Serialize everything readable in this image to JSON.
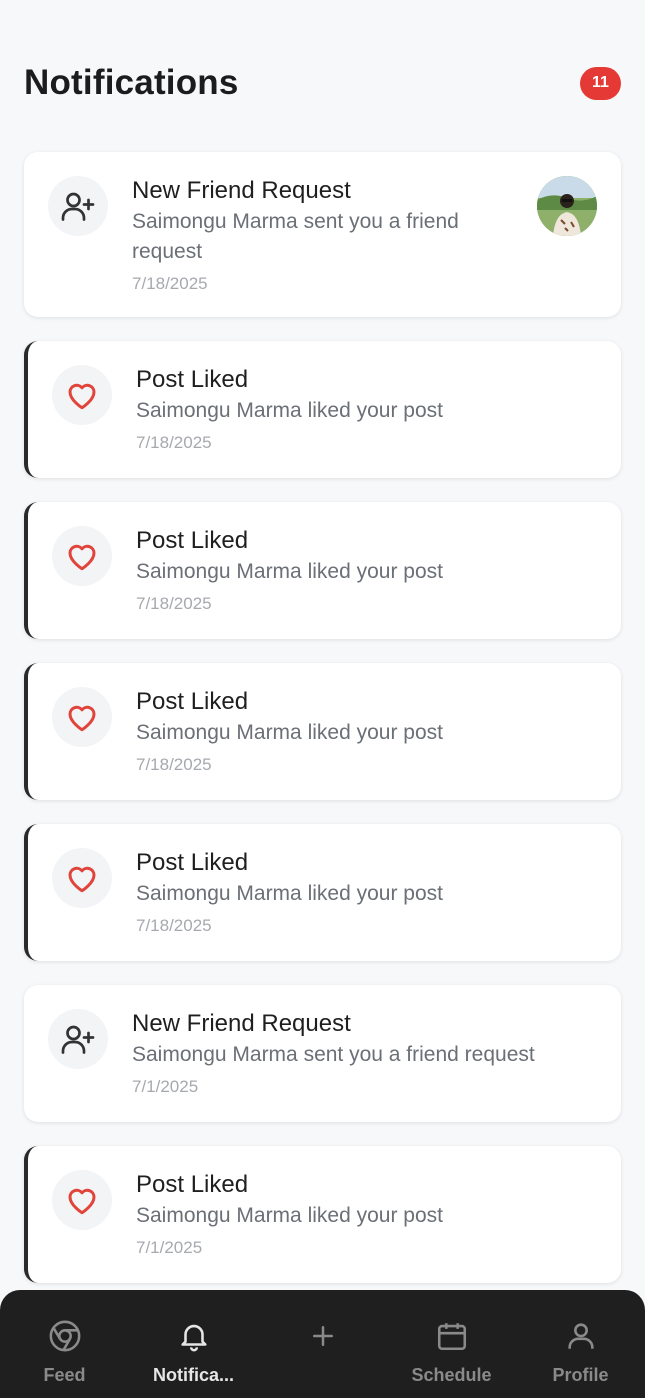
{
  "header": {
    "title": "Notifications",
    "unread_count": "11"
  },
  "colors": {
    "badge": "#e53935",
    "heart": "#e0443a",
    "unread_accent": "#2a2a2a",
    "tabbar": "#1f1f1f"
  },
  "notifications": [
    {
      "type": "friend_request",
      "icon": "user-plus-icon",
      "title": "New Friend Request",
      "message": "Saimongu Marma sent you a friend request",
      "date": "7/18/2025",
      "unread": false,
      "has_avatar": true
    },
    {
      "type": "post_liked",
      "icon": "heart-icon",
      "title": "Post Liked",
      "message": "Saimongu Marma liked your post",
      "date": "7/18/2025",
      "unread": true
    },
    {
      "type": "post_liked",
      "icon": "heart-icon",
      "title": "Post Liked",
      "message": "Saimongu Marma liked your post",
      "date": "7/18/2025",
      "unread": true
    },
    {
      "type": "post_liked",
      "icon": "heart-icon",
      "title": "Post Liked",
      "message": "Saimongu Marma liked your post",
      "date": "7/18/2025",
      "unread": true
    },
    {
      "type": "post_liked",
      "icon": "heart-icon",
      "title": "Post Liked",
      "message": "Saimongu Marma liked your post",
      "date": "7/18/2025",
      "unread": true
    },
    {
      "type": "friend_request",
      "icon": "user-plus-icon",
      "title": "New Friend Request",
      "message": "Saimongu Marma sent you a friend request",
      "date": "7/1/2025",
      "unread": false,
      "has_avatar": false
    },
    {
      "type": "post_liked",
      "icon": "heart-icon",
      "title": "Post Liked",
      "message": "Saimongu Marma liked your post",
      "date": "7/1/2025",
      "unread": true
    }
  ],
  "tabbar": {
    "items": [
      {
        "label": "Feed",
        "icon": "feed-icon",
        "active": false
      },
      {
        "label": "Notifica...",
        "icon": "bell-icon",
        "active": true
      },
      {
        "label": "",
        "icon": "plus-icon",
        "active": false
      },
      {
        "label": "Schedule",
        "icon": "calendar-icon",
        "active": false
      },
      {
        "label": "Profile",
        "icon": "user-icon",
        "active": false
      }
    ]
  }
}
